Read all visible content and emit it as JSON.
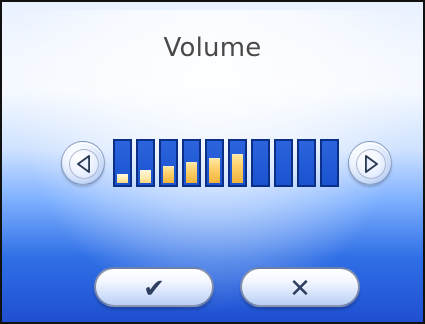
{
  "window": {
    "title": "Volume"
  },
  "volume": {
    "level": 6,
    "max": 10
  },
  "controls": {
    "decrease_icon": "left-triangle-icon",
    "increase_icon": "right-triangle-icon"
  },
  "buttons": {
    "ok_glyph": "✔",
    "cancel_glyph": "✕"
  },
  "colors": {
    "bar_empty": "#1a53cf",
    "bar_border": "#0b2f86",
    "bar_fill": "#f0b33a"
  }
}
